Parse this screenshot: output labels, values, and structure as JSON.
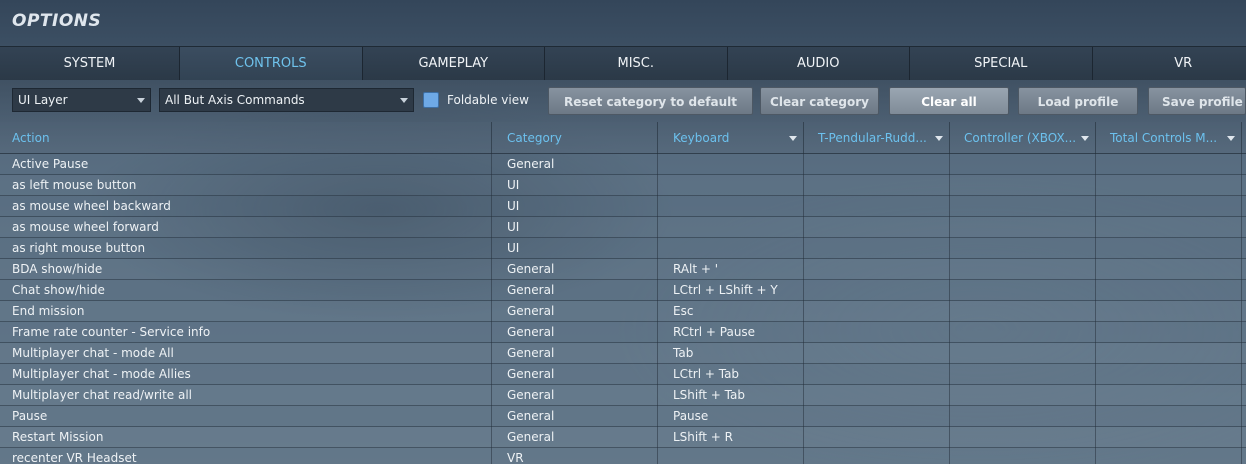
{
  "window": {
    "title": "OPTIONS"
  },
  "tabs": [
    {
      "label": "SYSTEM"
    },
    {
      "label": "CONTROLS",
      "active": true
    },
    {
      "label": "GAMEPLAY"
    },
    {
      "label": "MISC."
    },
    {
      "label": "AUDIO"
    },
    {
      "label": "SPECIAL"
    },
    {
      "label": "VR"
    }
  ],
  "toolbar": {
    "layer_select": {
      "value": "UI Layer"
    },
    "filter_select": {
      "value": "All But Axis Commands"
    },
    "foldable_view": {
      "label": "Foldable view",
      "checked": true
    },
    "buttons": {
      "reset": "Reset category to default",
      "clear_category": "Clear category",
      "clear_all": "Clear all",
      "load_profile": "Load profile",
      "save_profile": "Save profile a"
    }
  },
  "columns": {
    "action": "Action",
    "category": "Category",
    "keyboard": "Keyboard",
    "device1": "T-Pendular-Rudd...",
    "device2": "Controller (XBOX...",
    "device3": "Total Controls M..."
  },
  "rows": [
    {
      "action": "Active Pause",
      "category": "General",
      "keyboard": ""
    },
    {
      "action": "as left mouse button",
      "category": "UI",
      "keyboard": ""
    },
    {
      "action": "as mouse wheel backward",
      "category": "UI",
      "keyboard": ""
    },
    {
      "action": "as mouse wheel forward",
      "category": "UI",
      "keyboard": ""
    },
    {
      "action": "as right mouse button",
      "category": "UI",
      "keyboard": ""
    },
    {
      "action": "BDA show/hide",
      "category": "General",
      "keyboard": "RAlt + '"
    },
    {
      "action": "Chat show/hide",
      "category": "General",
      "keyboard": "LCtrl + LShift + Y"
    },
    {
      "action": "End mission",
      "category": "General",
      "keyboard": "Esc"
    },
    {
      "action": "Frame rate counter - Service info",
      "category": "General",
      "keyboard": "RCtrl + Pause"
    },
    {
      "action": "Multiplayer chat - mode All",
      "category": "General",
      "keyboard": "Tab"
    },
    {
      "action": "Multiplayer chat - mode Allies",
      "category": "General",
      "keyboard": "LCtrl + Tab"
    },
    {
      "action": "Multiplayer chat read/write all",
      "category": "General",
      "keyboard": "LShift + Tab"
    },
    {
      "action": "Pause",
      "category": "General",
      "keyboard": "Pause"
    },
    {
      "action": "Restart Mission",
      "category": "General",
      "keyboard": "LShift + R"
    },
    {
      "action": "recenter VR Headset",
      "category": "VR",
      "keyboard": ""
    }
  ],
  "colors": {
    "accent": "#6fc2ec",
    "checkbox": "#6ea9e6"
  }
}
